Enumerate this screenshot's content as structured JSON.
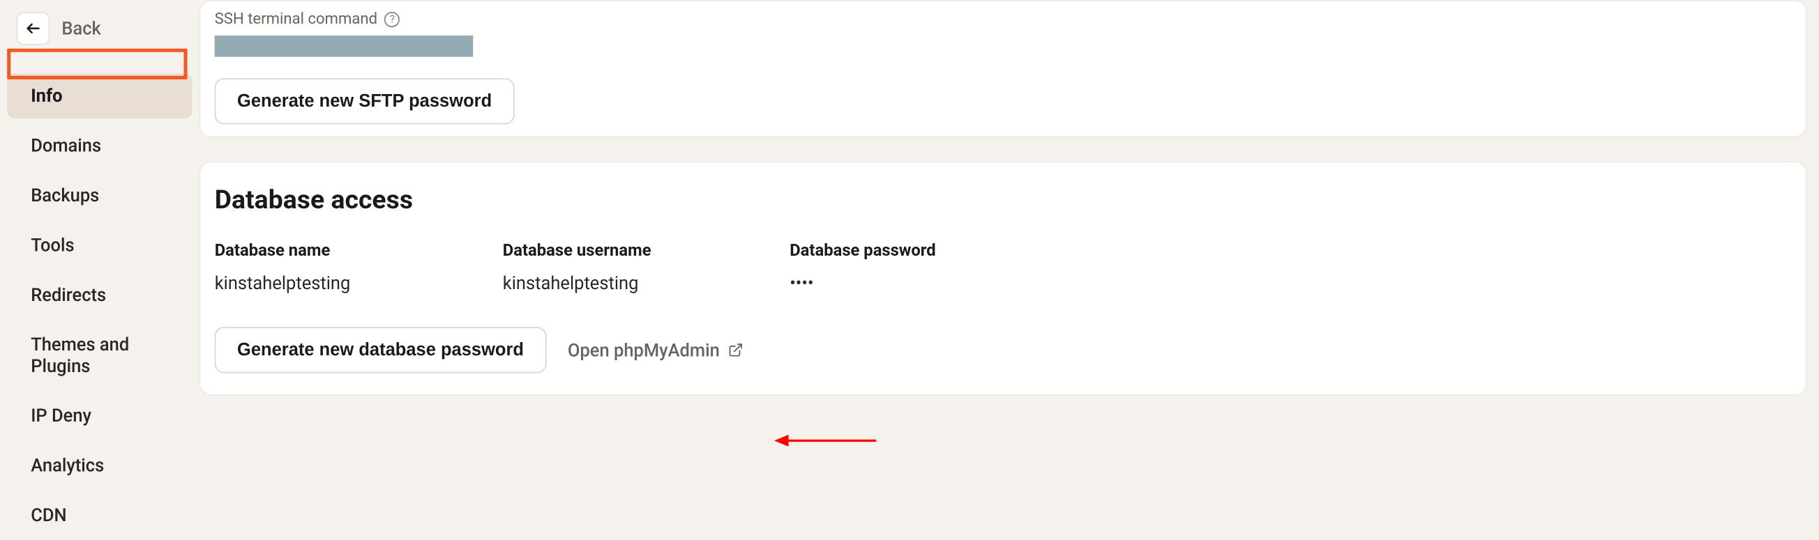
{
  "back": {
    "label": "Back"
  },
  "sidebar": {
    "items": [
      {
        "label": "Info",
        "active": true
      },
      {
        "label": "Domains",
        "active": false
      },
      {
        "label": "Backups",
        "active": false
      },
      {
        "label": "Tools",
        "active": false
      },
      {
        "label": "Redirects",
        "active": false
      },
      {
        "label": "Themes and Plugins",
        "active": false
      },
      {
        "label": "IP Deny",
        "active": false
      },
      {
        "label": "Analytics",
        "active": false
      },
      {
        "label": "CDN",
        "active": false
      }
    ]
  },
  "sftp": {
    "ssh_label": "SSH terminal command",
    "generate_btn": "Generate new SFTP password"
  },
  "database": {
    "title": "Database access",
    "name_label": "Database name",
    "name_value": "kinstahelptesting",
    "user_label": "Database username",
    "user_value": "kinstahelptesting",
    "pass_label": "Database password",
    "pass_value": "••••",
    "generate_btn": "Generate new database password",
    "phpmyadmin_label": "Open phpMyAdmin"
  }
}
